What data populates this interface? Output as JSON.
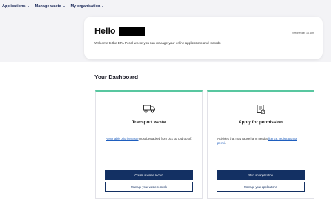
{
  "nav": {
    "items": [
      {
        "label": "Applications"
      },
      {
        "label": "Manage waste"
      },
      {
        "label": "My organisation"
      }
    ]
  },
  "hello": {
    "greeting": "Hello",
    "welcome": "Welcome to the EPA Portal where you can manage your online applications and records.",
    "date": "Wednesday 16 April"
  },
  "dashboard": {
    "title": "Your Dashboard",
    "cards": [
      {
        "icon": "truck-icon",
        "title": "Transport waste",
        "link_text": "Reportable priority waste",
        "desc_rest": " must be tracked from pick up to drop off.",
        "primary_button": "Create a waste record",
        "secondary_button": "Manage your waste records"
      },
      {
        "icon": "document-check-icon",
        "title": "Apply for permission",
        "desc_pre": "Activities that may cause harm need a ",
        "link_text": "licence, registration or permit",
        "desc_post": ".",
        "primary_button": "Start an application",
        "secondary_button": "Manage your applications"
      }
    ]
  },
  "colors": {
    "accent": "#58c7a0",
    "primary": "#133063",
    "link": "#1f5fbf",
    "background_band": "#f3f3f6"
  }
}
